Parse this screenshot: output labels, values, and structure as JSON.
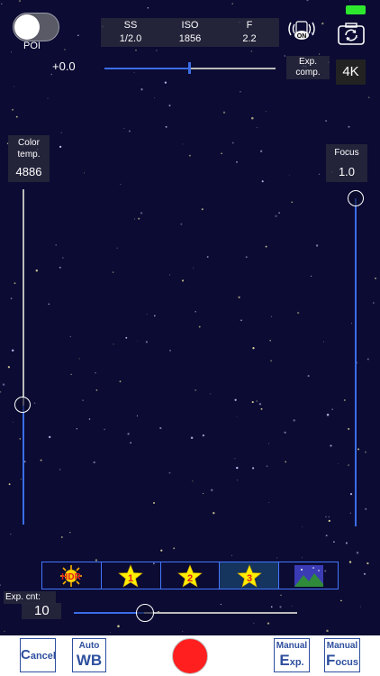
{
  "poi": {
    "label": "POI",
    "on": false
  },
  "info": {
    "ss": {
      "key": "SS",
      "value": "1/2.0"
    },
    "iso": {
      "key": "ISO",
      "value": "1856"
    },
    "f": {
      "key": "F",
      "value": "2.2"
    }
  },
  "rssi_badge": "ON",
  "exposure": {
    "value": "+0.0",
    "label_line1": "Exp.",
    "label_line2": "comp.",
    "level": 0.5
  },
  "resolution": "4K",
  "color_temp": {
    "label_line1": "Color",
    "label_line2": "temp.",
    "value": "4886",
    "level": 0.36
  },
  "focus": {
    "label": "Focus",
    "value": "1.0",
    "level": 1.0
  },
  "modes": {
    "items": [
      {
        "name": "hdr",
        "text": "HDR"
      },
      {
        "name": "star-1",
        "text": "1"
      },
      {
        "name": "star-2",
        "text": "2"
      },
      {
        "name": "star-3",
        "text": "3"
      },
      {
        "name": "landscape",
        "text": ""
      }
    ],
    "selected_index": 3
  },
  "exp_count": {
    "label": "Exp. cnt:",
    "value": "10",
    "level": 0.32
  },
  "toolbar": {
    "cancel_cap": "C",
    "cancel_rest": "ancel",
    "auto_wb_small": "Auto",
    "auto_wb_big": "WB",
    "manual_exp_small": "Manual",
    "manual_exp_cap": "E",
    "manual_exp_rest": "xp.",
    "manual_focus_small": "Manual",
    "manual_focus_cap": "F",
    "manual_focus_rest": "ocus"
  },
  "colors": {
    "accent": "#3b6de6",
    "shutter": "#ff1f1f",
    "button_text": "#2e4f9e",
    "sky": "#0b0b33"
  }
}
